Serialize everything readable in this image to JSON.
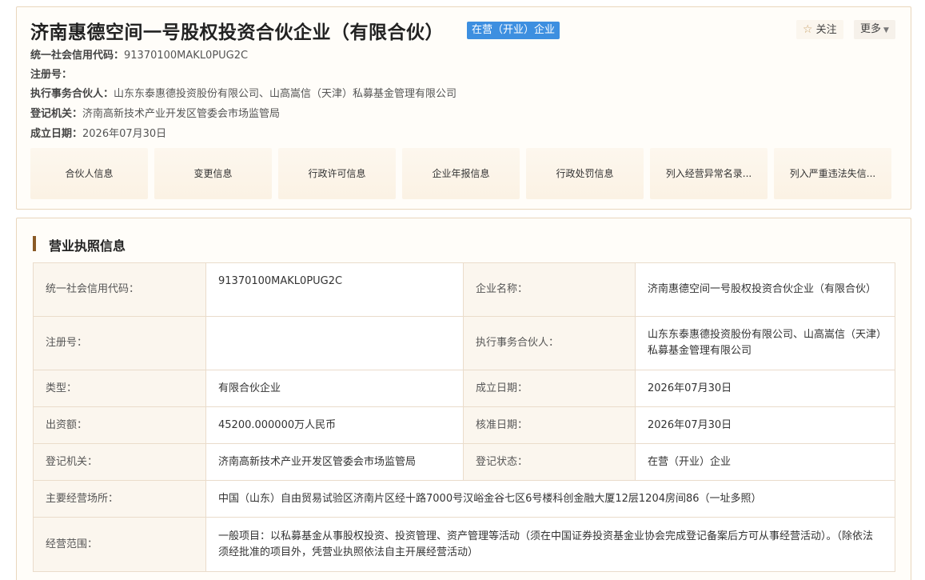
{
  "header": {
    "company_name": "济南惠德空间一号股权投资合伙企业（有限合伙）",
    "status_badge": "在营（开业）企业",
    "follow_label": "关注",
    "more_label": "更多",
    "lines": [
      {
        "key": "统一社会信用代码：",
        "value": "91370100MAKL0PUG2C"
      },
      {
        "key": "注册号：",
        "value": ""
      },
      {
        "key": "执行事务合伙人：",
        "value": "山东东泰惠德投资股份有限公司、山高嵩信（天津）私募基金管理有限公司"
      },
      {
        "key": "登记机关：",
        "value": "济南高新技术产业开发区管委会市场监管局"
      },
      {
        "key": "成立日期：",
        "value": "2026年07月30日"
      }
    ],
    "tabs": [
      "合伙人信息",
      "变更信息",
      "行政许可信息",
      "企业年报信息",
      "行政处罚信息",
      "列入经营异常名录...",
      "列入严重违法失信..."
    ]
  },
  "license": {
    "section_title": "营业执照信息",
    "rows": [
      {
        "l1": "统一社会信用代码：",
        "v1": "91370100MAKL0PUG2C",
        "l2": "企业名称：",
        "v2": "济南惠德空间一号股权投资合伙企业（有限合伙）"
      },
      {
        "l1": "注册号：",
        "v1": "",
        "l2": "执行事务合伙人：",
        "v2": "山东东泰惠德投资股份有限公司、山高嵩信（天津）私募基金管理有限公司"
      },
      {
        "l1": "类型：",
        "v1": "有限合伙企业",
        "l2": "成立日期：",
        "v2": "2026年07月30日"
      },
      {
        "l1": "出资额：",
        "v1": "45200.000000万人民币",
        "l2": "核准日期：",
        "v2": "2026年07月30日"
      },
      {
        "l1": "登记机关：",
        "v1": "济南高新技术产业开发区管委会市场监管局",
        "l2": "登记状态：",
        "v2": "在营（开业）企业"
      }
    ],
    "address_label": "主要经营场所：",
    "address_value": "中国（山东）自由贸易试验区济南片区经十路7000号汉峪金谷七区6号楼科创金融大厦12层1204房间86（一址多照）",
    "scope_label": "经营范围：",
    "scope_value": "一般项目：以私募基金从事股权投资、投资管理、资产管理等活动（须在中国证券投资基金业协会完成登记备案后方可从事经营活动）。（除依法须经批准的项目外，凭营业执照依法自主开展经营活动）"
  }
}
